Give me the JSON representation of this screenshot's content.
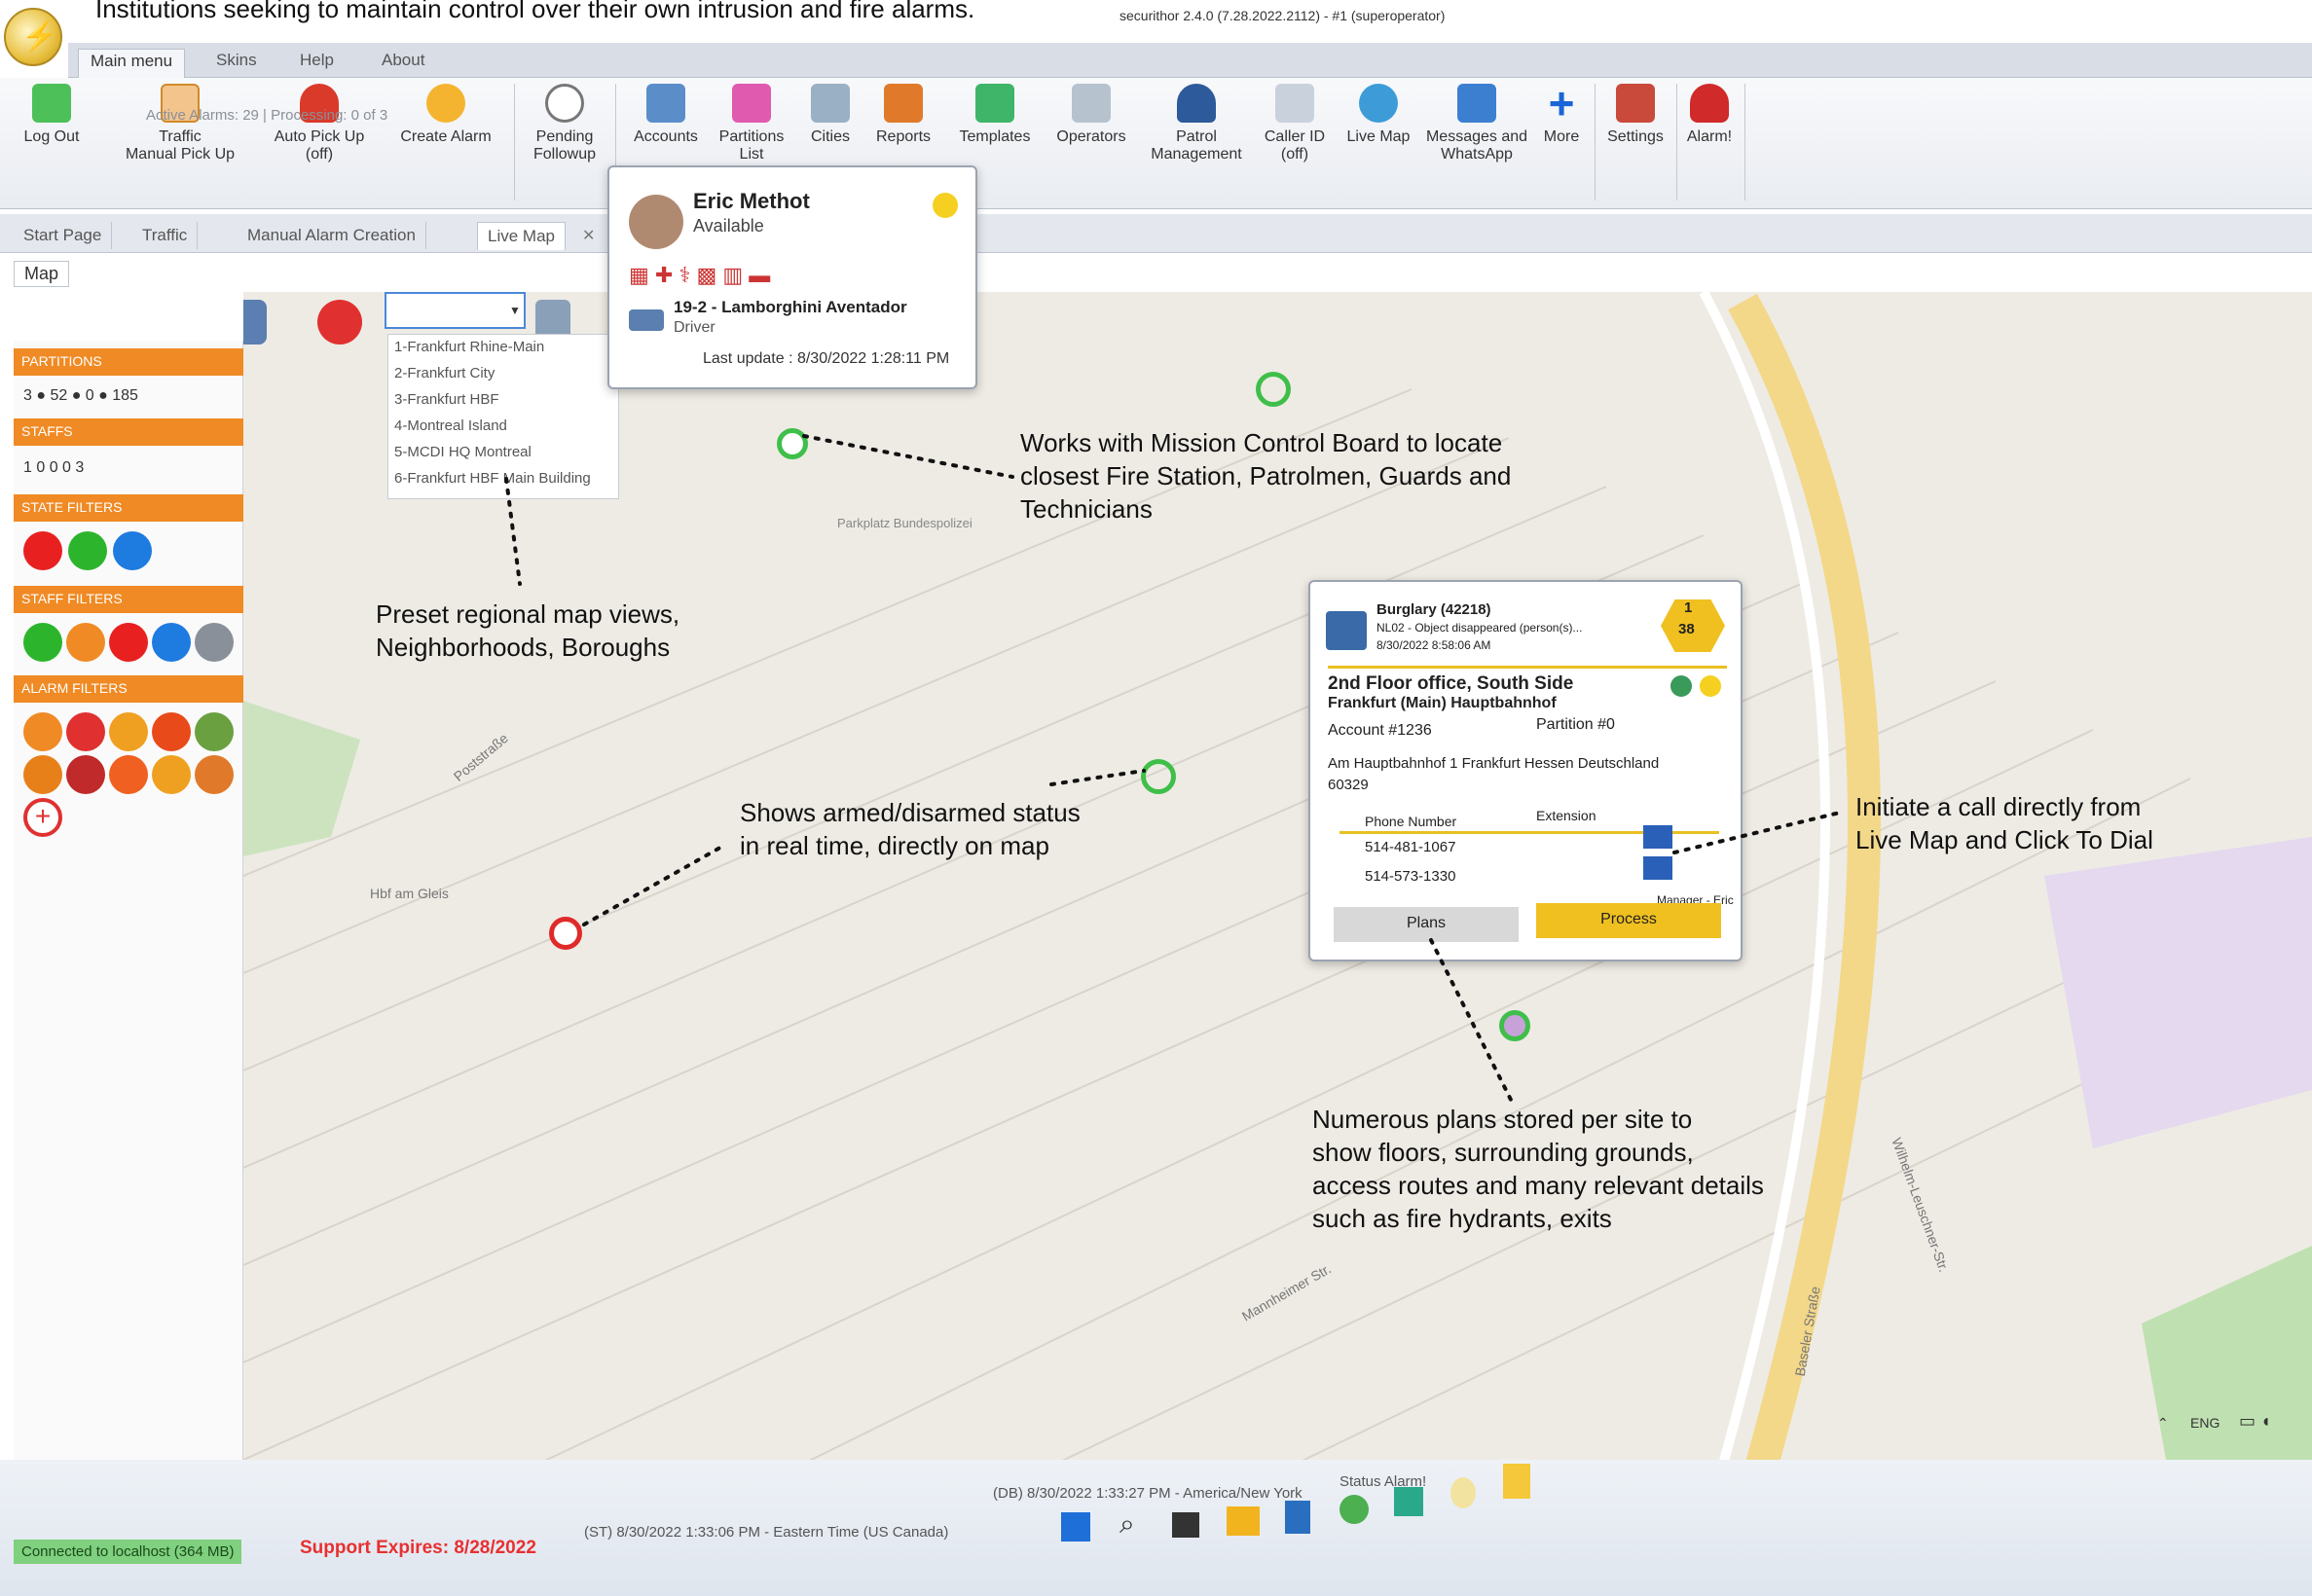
{
  "promo": "Institutions seeking to maintain control over their own intrusion and fire alarms.",
  "title_bar": "securithor 2.4.0 (7.28.2022.2112) - #1 (superoperator)",
  "menu_tabs": [
    "Main menu",
    "Skins",
    "Help",
    "About"
  ],
  "ribbon": {
    "log_out": "Log Out",
    "traffic": "Traffic\nManual Pick Up",
    "auto_pickup": "Auto Pick Up\n(off)",
    "create_alarm": "Create Alarm",
    "pending": "Pending\nFollowup",
    "accounts": "Accounts",
    "partitions": "Partitions\nList",
    "cities": "Cities",
    "reports": "Reports",
    "templates": "Templates",
    "operators": "Operators",
    "patrol": "Patrol\nManagement",
    "caller_id": "Caller ID\n(off)",
    "live_map": "Live Map",
    "messages": "Messages and\nWhatsApp",
    "more": "More",
    "settings": "Settings",
    "alarm": "Alarm!",
    "active_alarms": "Active Alarms: 29 | Processing: 0 of 3"
  },
  "page_tabs": [
    "Start Page",
    "Traffic",
    "Manual Alarm Creation",
    "Live Map"
  ],
  "map_tab": "Map",
  "left_panel": {
    "partitions_title": "PARTITIONS",
    "partitions_counts": "3 ● 52 ● 0 ● 185",
    "staffs_title": "STAFFS",
    "staffs_counts": "1  0  0  0  3",
    "state_filters": "STATE FILTERS",
    "staff_filters": "STAFF FILTERS",
    "alarm_filters": "ALARM FILTERS"
  },
  "dropdown_items": [
    "1-Frankfurt Rhine-Main",
    "2-Frankfurt City",
    "3-Frankfurt HBF",
    "4-Montreal Island",
    "5-MCDI HQ Montreal",
    "6-Frankfurt HBF Main Building"
  ],
  "staff_popup": {
    "name": "Eric Methot",
    "status": "Available",
    "vehicle": "19-2 - Lamborghini Aventador",
    "role": "Driver",
    "last_update": "Last update : 8/30/2022 1:28:11 PM"
  },
  "alarm_popup": {
    "type": "Burglary (42218)",
    "detail": "NL02 - Object disappeared (person(s)...",
    "time": "8/30/2022 8:58:06 AM",
    "counter_top": "1",
    "counter_bottom": "38",
    "site": "2nd Floor office, South Side",
    "site2": "Frankfurt (Main) Hauptbahnhof",
    "account": "Account #1236",
    "partition": "Partition #0",
    "address": "Am Hauptbahnhof 1 Frankfurt Hessen Deutschland",
    "postal": "60329",
    "phone_header": "Phone Number",
    "ext_header": "Extension",
    "phone1": "514-481-1067",
    "phone2": "514-573-1330",
    "manager": "Manager - Eric METHOT",
    "plans_button": "Plans",
    "process_button": "Process"
  },
  "annotations": {
    "mission": [
      "Works with Mission Control Board to locate",
      "closest Fire Station, Patrolmen, Guards and",
      "Technicians"
    ],
    "preset": [
      "Preset regional map views,",
      "Neighborhoods, Boroughs"
    ],
    "armed": [
      "Shows armed/disarmed status",
      "in real time, directly on map"
    ],
    "call": [
      "Initiate a call directly from",
      "Live Map and Click To Dial"
    ],
    "plans": [
      "Numerous plans stored per site to",
      "show floors, surrounding grounds,",
      "access routes and many relevant details",
      "such as fire hydrants, exits"
    ]
  },
  "status_bar": {
    "connected": "Connected to localhost (364 MB)",
    "support": "Support Expires: 8/28/2022",
    "time_est": "(ST) 8/30/2022 1:33:06 PM - Eastern Time (US Canada)",
    "time_ny": "(DB) 8/30/2022 1:33:27 PM - America/New York",
    "status_alarm": "Status Alarm!"
  },
  "tray": "ENG",
  "map_labels": [
    "Hbf am Gleis",
    "Poststraße",
    "Parkplatz Bundespolizei",
    "Mannheimer Str.",
    "Baseler Straße",
    "Wilhelm-Leuschner-Str."
  ]
}
